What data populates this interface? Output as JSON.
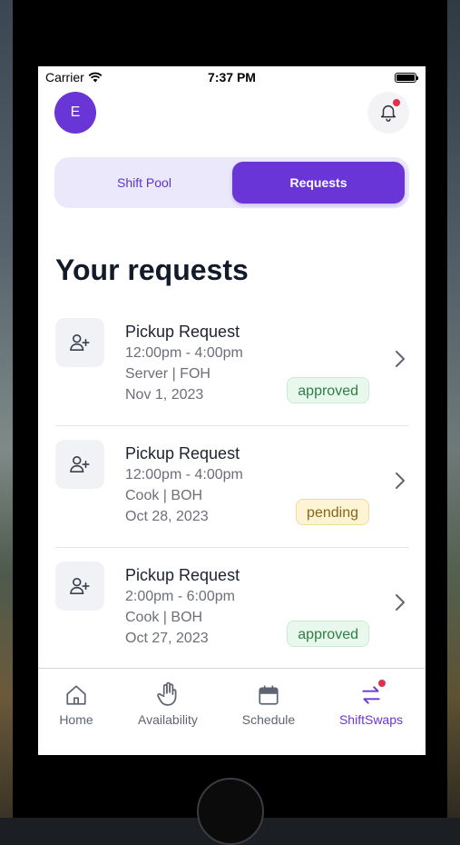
{
  "status_bar": {
    "carrier": "Carrier",
    "time": "7:37 PM"
  },
  "header": {
    "avatar_initial": "E"
  },
  "segmented": {
    "shift_pool": "Shift Pool",
    "requests": "Requests",
    "selected": "Requests"
  },
  "title": "Your requests",
  "requests": [
    {
      "title": "Pickup Request",
      "time": "12:00pm - 4:00pm",
      "role": "Server | FOH",
      "date": "Nov 1, 2023",
      "status": "approved"
    },
    {
      "title": "Pickup Request",
      "time": "12:00pm - 4:00pm",
      "role": "Cook | BOH",
      "date": "Oct 28, 2023",
      "status": "pending"
    },
    {
      "title": "Pickup Request",
      "time": "2:00pm - 6:00pm",
      "role": "Cook | BOH",
      "date": "Oct 27, 2023",
      "status": "approved"
    }
  ],
  "tabbar": {
    "items": [
      {
        "label": "Home",
        "icon": "home-icon"
      },
      {
        "label": "Availability",
        "icon": "hand-icon"
      },
      {
        "label": "Schedule",
        "icon": "calendar-icon"
      },
      {
        "label": "ShiftSwaps",
        "icon": "swap-icon"
      }
    ],
    "active": "ShiftSwaps"
  },
  "colors": {
    "accent": "#6a35d6",
    "notification": "#e0304a",
    "approved": "#2f7d46",
    "pending": "#8b6410"
  }
}
